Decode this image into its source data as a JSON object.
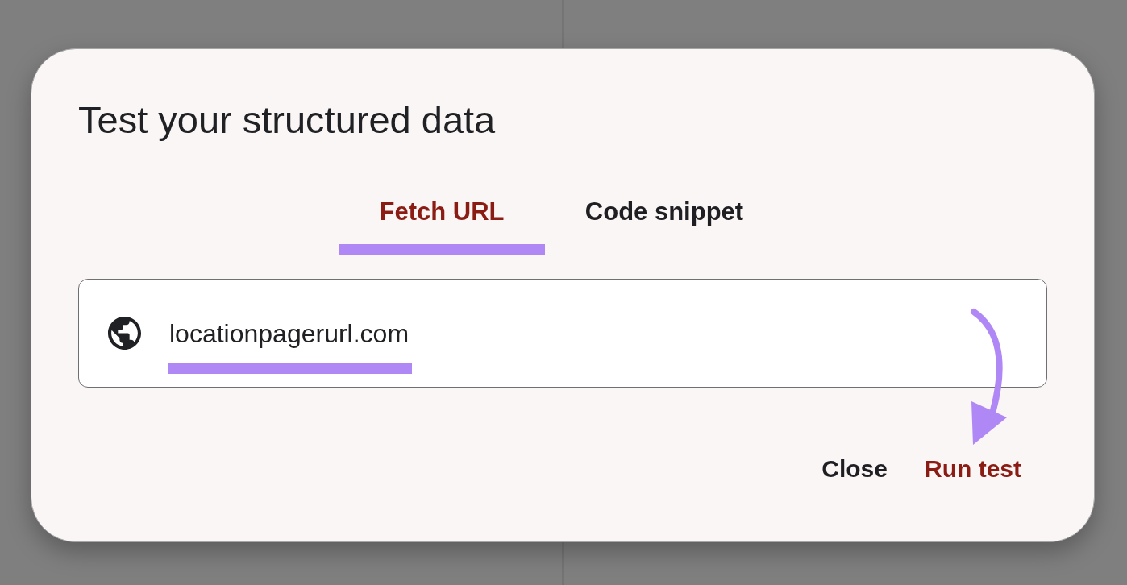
{
  "dialog": {
    "title": "Test your structured data",
    "tabs": [
      {
        "label": "Fetch URL",
        "selected": true
      },
      {
        "label": "Code snippet",
        "selected": false
      }
    ],
    "url_field": {
      "value": "locationpagerurl.com"
    },
    "buttons": [
      {
        "label": "Close",
        "kind": "secondary"
      },
      {
        "label": "Run test",
        "kind": "primary"
      }
    ]
  }
}
